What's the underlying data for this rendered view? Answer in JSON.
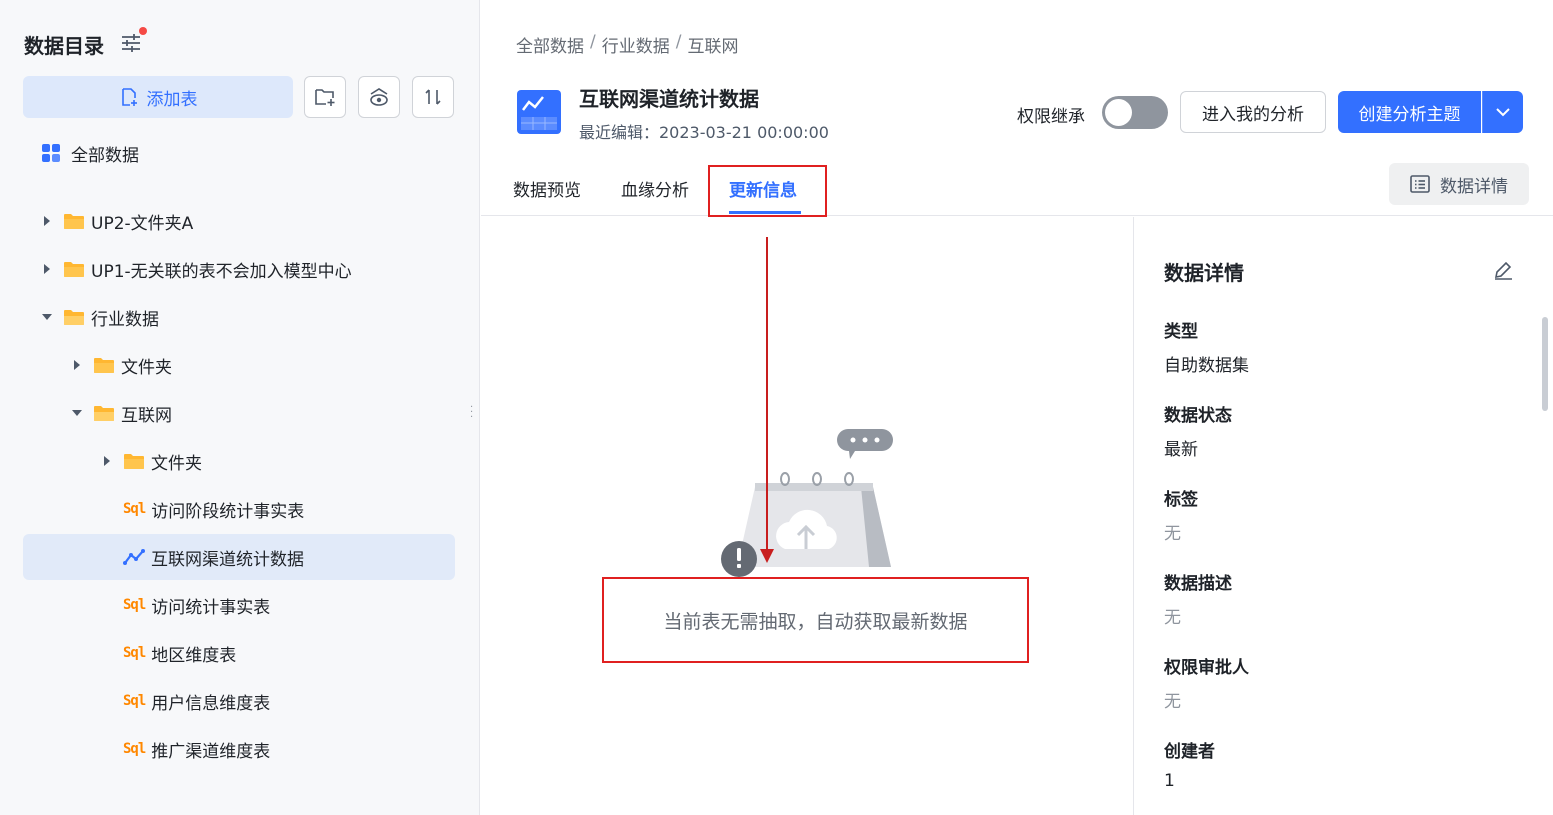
{
  "sidebar": {
    "title": "数据目录",
    "add_table_label": "添加表",
    "tree": [
      {
        "label": "全部数据",
        "type": "root",
        "indent": 0
      },
      {
        "label": "UP2-文件夹A",
        "type": "folder",
        "indent": 0,
        "caret": "right"
      },
      {
        "label": "UP1-无关联的表不会加入模型中心",
        "type": "folder",
        "indent": 0,
        "caret": "right"
      },
      {
        "label": "行业数据",
        "type": "folder-open",
        "indent": 0,
        "caret": "down"
      },
      {
        "label": "文件夹",
        "type": "folder",
        "indent": 1,
        "caret": "right"
      },
      {
        "label": "互联网",
        "type": "folder-open",
        "indent": 1,
        "caret": "down"
      },
      {
        "label": "文件夹",
        "type": "folder",
        "indent": 2,
        "caret": "right"
      },
      {
        "label": "访问阶段统计事实表",
        "type": "sql",
        "indent": 2
      },
      {
        "label": "互联网渠道统计数据",
        "type": "analysis",
        "indent": 2,
        "selected": true
      },
      {
        "label": "访问统计事实表",
        "type": "sql",
        "indent": 2
      },
      {
        "label": "地区维度表",
        "type": "sql",
        "indent": 2
      },
      {
        "label": "用户信息维度表",
        "type": "sql",
        "indent": 2
      },
      {
        "label": "推广渠道维度表",
        "type": "sql",
        "indent": 2
      }
    ]
  },
  "header": {
    "breadcrumb": [
      "全部数据",
      "行业数据",
      "互联网"
    ],
    "title": "互联网渠道统计数据",
    "edit_time": "最近编辑：2023-03-21 00:00:00",
    "permission_label": "权限继承",
    "enter_analysis_label": "进入我的分析",
    "create_topic_label": "创建分析主题"
  },
  "tabs": {
    "preview": "数据预览",
    "lineage": "血缘分析",
    "update": "更新信息",
    "detail_button": "数据详情"
  },
  "content": {
    "empty_message": "当前表无需抽取，自动获取最新数据"
  },
  "panel": {
    "title": "数据详情",
    "fields": [
      {
        "label": "类型",
        "value": "自助数据集",
        "muted": false
      },
      {
        "label": "数据状态",
        "value": "最新",
        "muted": false
      },
      {
        "label": "标签",
        "value": "无",
        "muted": true
      },
      {
        "label": "数据描述",
        "value": "无",
        "muted": true
      },
      {
        "label": "权限审批人",
        "value": "无",
        "muted": true
      },
      {
        "label": "创建者",
        "value": "1",
        "muted": false
      }
    ]
  },
  "colors": {
    "primary": "#3370ff",
    "annotation_red": "#e02020",
    "sql_orange": "#ff8800",
    "folder": "#ffb731"
  }
}
